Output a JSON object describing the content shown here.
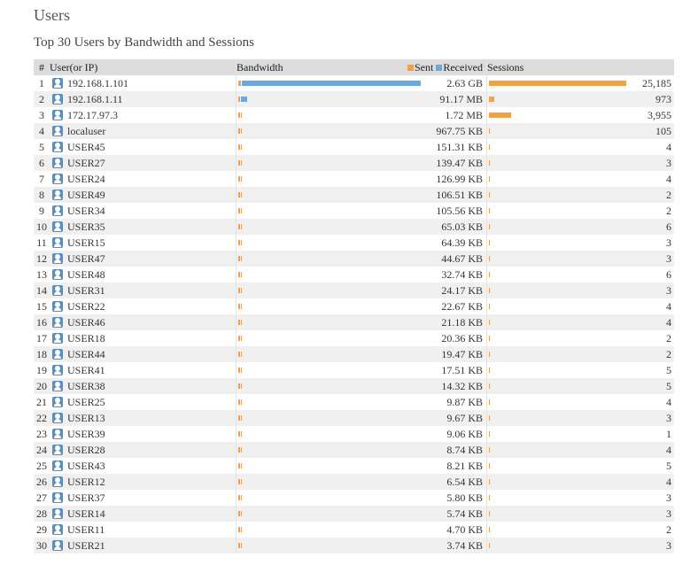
{
  "page": {
    "title": "Users",
    "subtitle": "Top 30 Users by Bandwidth and Sessions"
  },
  "colors": {
    "sent": "#f0a245",
    "received": "#6aa9e0",
    "sessions": "#f0a245"
  },
  "table": {
    "headers": {
      "rank": "#",
      "user": "User(or IP)",
      "bandwidth": "Bandwidth",
      "sent": "Sent",
      "received": "Received",
      "sessions": "Sessions"
    },
    "rows": [
      {
        "rank": "1",
        "user": "192.168.1.101",
        "bandwidth": "2.63 GB",
        "sessions": "25,185",
        "sent_frac": 0.015,
        "recv_frac": 0.96,
        "sess_frac": 0.97
      },
      {
        "rank": "2",
        "user": "192.168.1.11",
        "bandwidth": "91.17 MB",
        "sessions": "973",
        "sent_frac": 0.0,
        "recv_frac": 0.035,
        "sess_frac": 0.038
      },
      {
        "rank": "3",
        "user": "172.17.97.3",
        "bandwidth": "1.72 MB",
        "sessions": "3,955",
        "sent_frac": 0.0,
        "recv_frac": 0.003,
        "sess_frac": 0.157
      },
      {
        "rank": "4",
        "user": "localuser",
        "bandwidth": "967.75 KB",
        "sessions": "105",
        "sent_frac": 0.0,
        "recv_frac": 0.002,
        "sess_frac": 0.004
      },
      {
        "rank": "5",
        "user": "USER45",
        "bandwidth": "151.31 KB",
        "sessions": "4",
        "sent_frac": 0.0,
        "recv_frac": 0.001,
        "sess_frac": 0.001
      },
      {
        "rank": "6",
        "user": "USER27",
        "bandwidth": "139.47 KB",
        "sessions": "3",
        "sent_frac": 0.0,
        "recv_frac": 0.001,
        "sess_frac": 0.001
      },
      {
        "rank": "7",
        "user": "USER24",
        "bandwidth": "126.99 KB",
        "sessions": "4",
        "sent_frac": 0.0,
        "recv_frac": 0.001,
        "sess_frac": 0.001
      },
      {
        "rank": "8",
        "user": "USER49",
        "bandwidth": "106.51 KB",
        "sessions": "2",
        "sent_frac": 0.0,
        "recv_frac": 0.001,
        "sess_frac": 0.001
      },
      {
        "rank": "9",
        "user": "USER34",
        "bandwidth": "105.56 KB",
        "sessions": "2",
        "sent_frac": 0.0,
        "recv_frac": 0.001,
        "sess_frac": 0.001
      },
      {
        "rank": "10",
        "user": "USER35",
        "bandwidth": "65.03 KB",
        "sessions": "6",
        "sent_frac": 0.0,
        "recv_frac": 0.001,
        "sess_frac": 0.001
      },
      {
        "rank": "11",
        "user": "USER15",
        "bandwidth": "64.39 KB",
        "sessions": "3",
        "sent_frac": 0.0,
        "recv_frac": 0.001,
        "sess_frac": 0.001
      },
      {
        "rank": "12",
        "user": "USER47",
        "bandwidth": "44.67 KB",
        "sessions": "3",
        "sent_frac": 0.0,
        "recv_frac": 0.001,
        "sess_frac": 0.001
      },
      {
        "rank": "13",
        "user": "USER48",
        "bandwidth": "32.74 KB",
        "sessions": "6",
        "sent_frac": 0.0,
        "recv_frac": 0.001,
        "sess_frac": 0.001
      },
      {
        "rank": "14",
        "user": "USER31",
        "bandwidth": "24.17 KB",
        "sessions": "3",
        "sent_frac": 0.0,
        "recv_frac": 0.001,
        "sess_frac": 0.001
      },
      {
        "rank": "15",
        "user": "USER22",
        "bandwidth": "22.67 KB",
        "sessions": "4",
        "sent_frac": 0.0,
        "recv_frac": 0.001,
        "sess_frac": 0.001
      },
      {
        "rank": "16",
        "user": "USER46",
        "bandwidth": "21.18 KB",
        "sessions": "4",
        "sent_frac": 0.0,
        "recv_frac": 0.001,
        "sess_frac": 0.001
      },
      {
        "rank": "17",
        "user": "USER18",
        "bandwidth": "20.36 KB",
        "sessions": "2",
        "sent_frac": 0.0,
        "recv_frac": 0.001,
        "sess_frac": 0.001
      },
      {
        "rank": "18",
        "user": "USER44",
        "bandwidth": "19.47 KB",
        "sessions": "2",
        "sent_frac": 0.0,
        "recv_frac": 0.001,
        "sess_frac": 0.001
      },
      {
        "rank": "19",
        "user": "USER41",
        "bandwidth": "17.51 KB",
        "sessions": "5",
        "sent_frac": 0.0,
        "recv_frac": 0.001,
        "sess_frac": 0.001
      },
      {
        "rank": "20",
        "user": "USER38",
        "bandwidth": "14.32 KB",
        "sessions": "5",
        "sent_frac": 0.0,
        "recv_frac": 0.001,
        "sess_frac": 0.001
      },
      {
        "rank": "21",
        "user": "USER25",
        "bandwidth": "9.87 KB",
        "sessions": "4",
        "sent_frac": 0.0,
        "recv_frac": 0.001,
        "sess_frac": 0.001
      },
      {
        "rank": "22",
        "user": "USER13",
        "bandwidth": "9.67 KB",
        "sessions": "3",
        "sent_frac": 0.0,
        "recv_frac": 0.001,
        "sess_frac": 0.001
      },
      {
        "rank": "23",
        "user": "USER39",
        "bandwidth": "9.06 KB",
        "sessions": "1",
        "sent_frac": 0.0,
        "recv_frac": 0.001,
        "sess_frac": 0.001
      },
      {
        "rank": "24",
        "user": "USER28",
        "bandwidth": "8.74 KB",
        "sessions": "4",
        "sent_frac": 0.0,
        "recv_frac": 0.001,
        "sess_frac": 0.001
      },
      {
        "rank": "25",
        "user": "USER43",
        "bandwidth": "8.21 KB",
        "sessions": "5",
        "sent_frac": 0.0,
        "recv_frac": 0.001,
        "sess_frac": 0.001
      },
      {
        "rank": "26",
        "user": "USER12",
        "bandwidth": "6.54 KB",
        "sessions": "4",
        "sent_frac": 0.0,
        "recv_frac": 0.001,
        "sess_frac": 0.001
      },
      {
        "rank": "27",
        "user": "USER37",
        "bandwidth": "5.80 KB",
        "sessions": "3",
        "sent_frac": 0.0,
        "recv_frac": 0.001,
        "sess_frac": 0.001
      },
      {
        "rank": "28",
        "user": "USER14",
        "bandwidth": "5.74 KB",
        "sessions": "3",
        "sent_frac": 0.0,
        "recv_frac": 0.001,
        "sess_frac": 0.001
      },
      {
        "rank": "29",
        "user": "USER11",
        "bandwidth": "4.70 KB",
        "sessions": "2",
        "sent_frac": 0.0,
        "recv_frac": 0.001,
        "sess_frac": 0.001
      },
      {
        "rank": "30",
        "user": "USER21",
        "bandwidth": "3.74 KB",
        "sessions": "3",
        "sent_frac": 0.0,
        "recv_frac": 0.001,
        "sess_frac": 0.001
      }
    ]
  }
}
